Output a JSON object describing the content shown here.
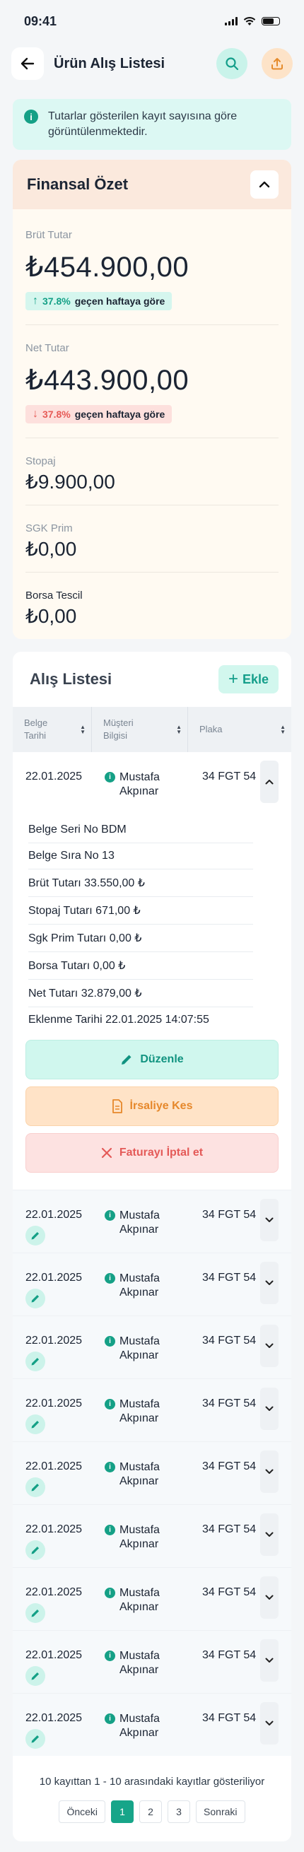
{
  "status": {
    "time": "09:41"
  },
  "header": {
    "title": "Ürün Alış Listesi",
    "back_icon": "arrow-left-icon",
    "search_icon": "search-icon",
    "export_icon": "upload-icon"
  },
  "info": {
    "text": "Tutarlar gösterilen kayıt sayısına göre görüntülenmektedir."
  },
  "finance": {
    "title": "Finansal Özet",
    "gross": {
      "label": "Brüt Tutar",
      "value": "₺454.900,00",
      "pct": "37.8%",
      "text": "geçen haftaya göre"
    },
    "net": {
      "label": "Net Tutar",
      "value": "₺443.900,00",
      "pct": "37.8%",
      "text": "geçen haftaya göre"
    },
    "stopaj": {
      "label": "Stopaj",
      "value": "₺9.900,00"
    },
    "sgk": {
      "label": "SGK Prim",
      "value": "₺0,00"
    },
    "borsa": {
      "label": "Borsa Tescil",
      "value": "₺0,00"
    }
  },
  "list": {
    "title": "Alış Listesi",
    "add_label": "Ekle",
    "columns": {
      "col1": "Belge Tarihi",
      "col2": "Müşteri Bilgisi",
      "col3": "Plaka"
    },
    "rows": [
      {
        "date": "22.01.2025",
        "cust1": "Mustafa",
        "cust2": "Akpınar",
        "plate": "34 FGT 54"
      },
      {
        "date": "22.01.2025",
        "cust1": "Mustafa",
        "cust2": "Akpınar",
        "plate": "34 FGT 54"
      },
      {
        "date": "22.01.2025",
        "cust1": "Mustafa",
        "cust2": "Akpınar",
        "plate": "34 FGT 54"
      },
      {
        "date": "22.01.2025",
        "cust1": "Mustafa",
        "cust2": "Akpınar",
        "plate": "34 FGT 54"
      },
      {
        "date": "22.01.2025",
        "cust1": "Mustafa",
        "cust2": "Akpınar",
        "plate": "34 FGT 54"
      },
      {
        "date": "22.01.2025",
        "cust1": "Mustafa",
        "cust2": "Akpınar",
        "plate": "34 FGT 54"
      },
      {
        "date": "22.01.2025",
        "cust1": "Mustafa",
        "cust2": "Akpınar",
        "plate": "34 FGT 54"
      },
      {
        "date": "22.01.2025",
        "cust1": "Mustafa",
        "cust2": "Akpınar",
        "plate": "34 FGT 54"
      },
      {
        "date": "22.01.2025",
        "cust1": "Mustafa",
        "cust2": "Akpınar",
        "plate": "34 FGT 54"
      },
      {
        "date": "22.01.2025",
        "cust1": "Mustafa",
        "cust2": "Akpınar",
        "plate": "34 FGT 54"
      }
    ],
    "details": [
      "Belge Seri No BDM",
      "Belge Sıra No 13",
      "Brüt Tutarı 33.550,00 ₺",
      "Stopaj Tutarı 671,00 ₺",
      "Sgk Prim Tutarı 0,00 ₺",
      "Borsa Tutarı 0,00 ₺",
      "Net Tutarı 32.879,00 ₺",
      "Eklenme Tarihi 22.01.2025 14:07:55"
    ],
    "actions": {
      "edit": "Düzenle",
      "waybill": "İrsaliye Kes",
      "cancel": "Faturayı İptal et"
    }
  },
  "pagination": {
    "summary": "10 kayıttan 1 - 10 arasındaki kayıtlar gösteriliyor",
    "prev": "Önceki",
    "pages": [
      "1",
      "2",
      "3"
    ],
    "next": "Sonraki",
    "active": "1"
  },
  "colors": {
    "accent": "#17a589",
    "accent_light": "#d2f7ee",
    "orange": "#e6882b",
    "red": "#e45a58"
  }
}
